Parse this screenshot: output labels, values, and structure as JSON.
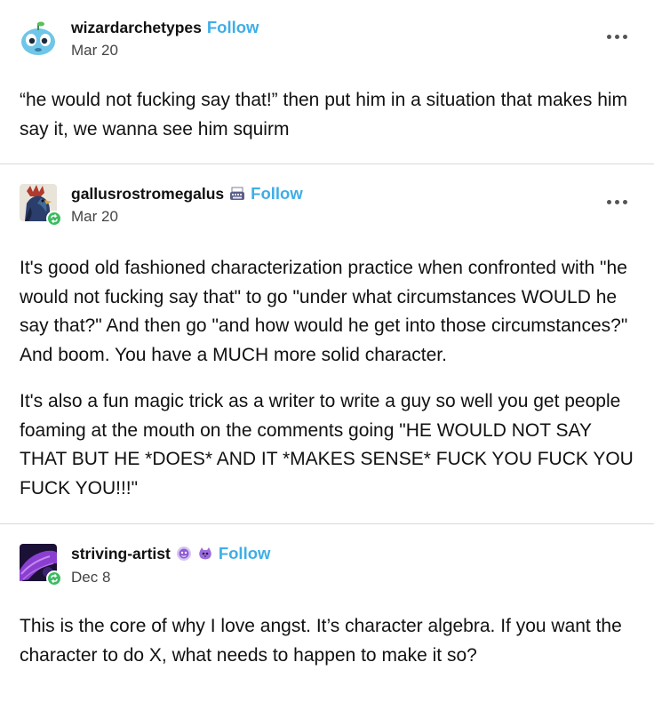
{
  "posts": [
    {
      "username": "wizardarchetypes",
      "follow_label": "Follow",
      "date": "Mar 20",
      "avatar_icon": "blue-cartoon-creature-avatar",
      "paragraphs": [
        "“he would not fucking say that!” then put him in a situation that makes him say it, we wanna see him squirm"
      ]
    },
    {
      "username": "gallusrostromegalus",
      "follow_label": "Follow",
      "date": "Mar 20",
      "avatar_icon": "rooster-avatar",
      "badge_icon": "typewriter-icon",
      "reblog_badge": "reblog-icon",
      "paragraphs": [
        "It's good old fashioned characterization practice when confronted with \"he would not fucking say that\" to go \"under what circumstances WOULD he say that?\" And then go \"and how would he get into those circumstances?\" And boom. You have a MUCH more solid character.",
        "It's also a fun magic trick as a writer to write a guy so well you get people foaming at the mouth on the comments going \"HE WOULD NOT SAY THAT BUT HE *DOES* AND IT *MAKES SENSE* FUCK YOU FUCK YOU FUCK YOU!!!\""
      ]
    },
    {
      "username": "striving-artist",
      "follow_label": "Follow",
      "date": "Dec 8",
      "avatar_icon": "purple-hat-avatar",
      "badge_icons": [
        "purple-sticker-icon",
        "purple-creature-icon"
      ],
      "reblog_badge": "reblog-icon",
      "paragraphs": [
        "This is the core of why I love angst. It’s character algebra. If you want the character to do X, what needs to happen to make it so?"
      ]
    }
  ],
  "colors": {
    "follow": "#3eaee6",
    "reblog_badge": "#3dbb62",
    "divider": "#d9d9d9",
    "text": "#111111",
    "date": "#444444"
  }
}
